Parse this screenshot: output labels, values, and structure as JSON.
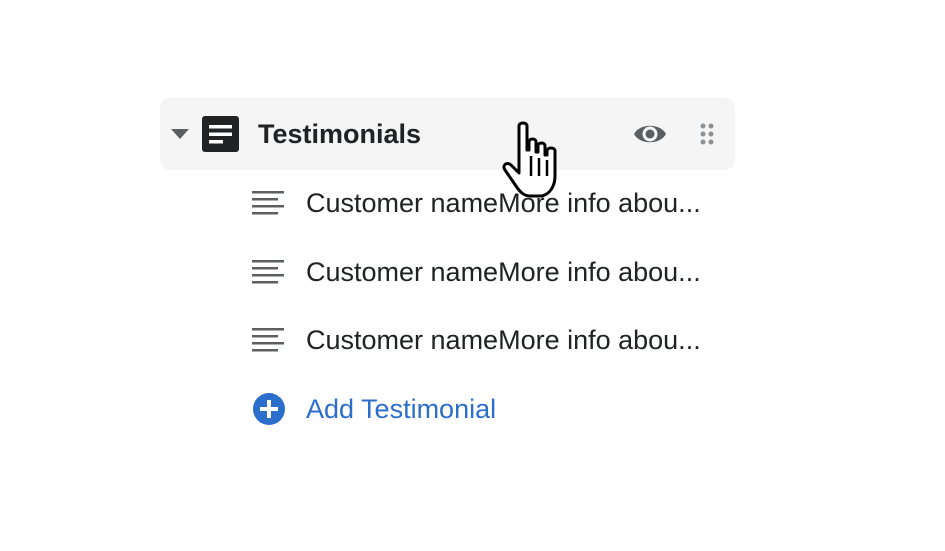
{
  "section": {
    "title": "Testimonials",
    "icon": "section-document-icon",
    "expanded": true
  },
  "items": [
    {
      "label": "Customer nameMore info abou..."
    },
    {
      "label": "Customer nameMore info abou..."
    },
    {
      "label": "Customer nameMore info abou..."
    }
  ],
  "add_button": {
    "label": "Add Testimonial",
    "icon": "plus-circle-icon"
  },
  "colors": {
    "accent": "#2c6ecb",
    "text": "#202223",
    "icon": "#5c5f62",
    "header_bg": "#f5f5f5"
  }
}
